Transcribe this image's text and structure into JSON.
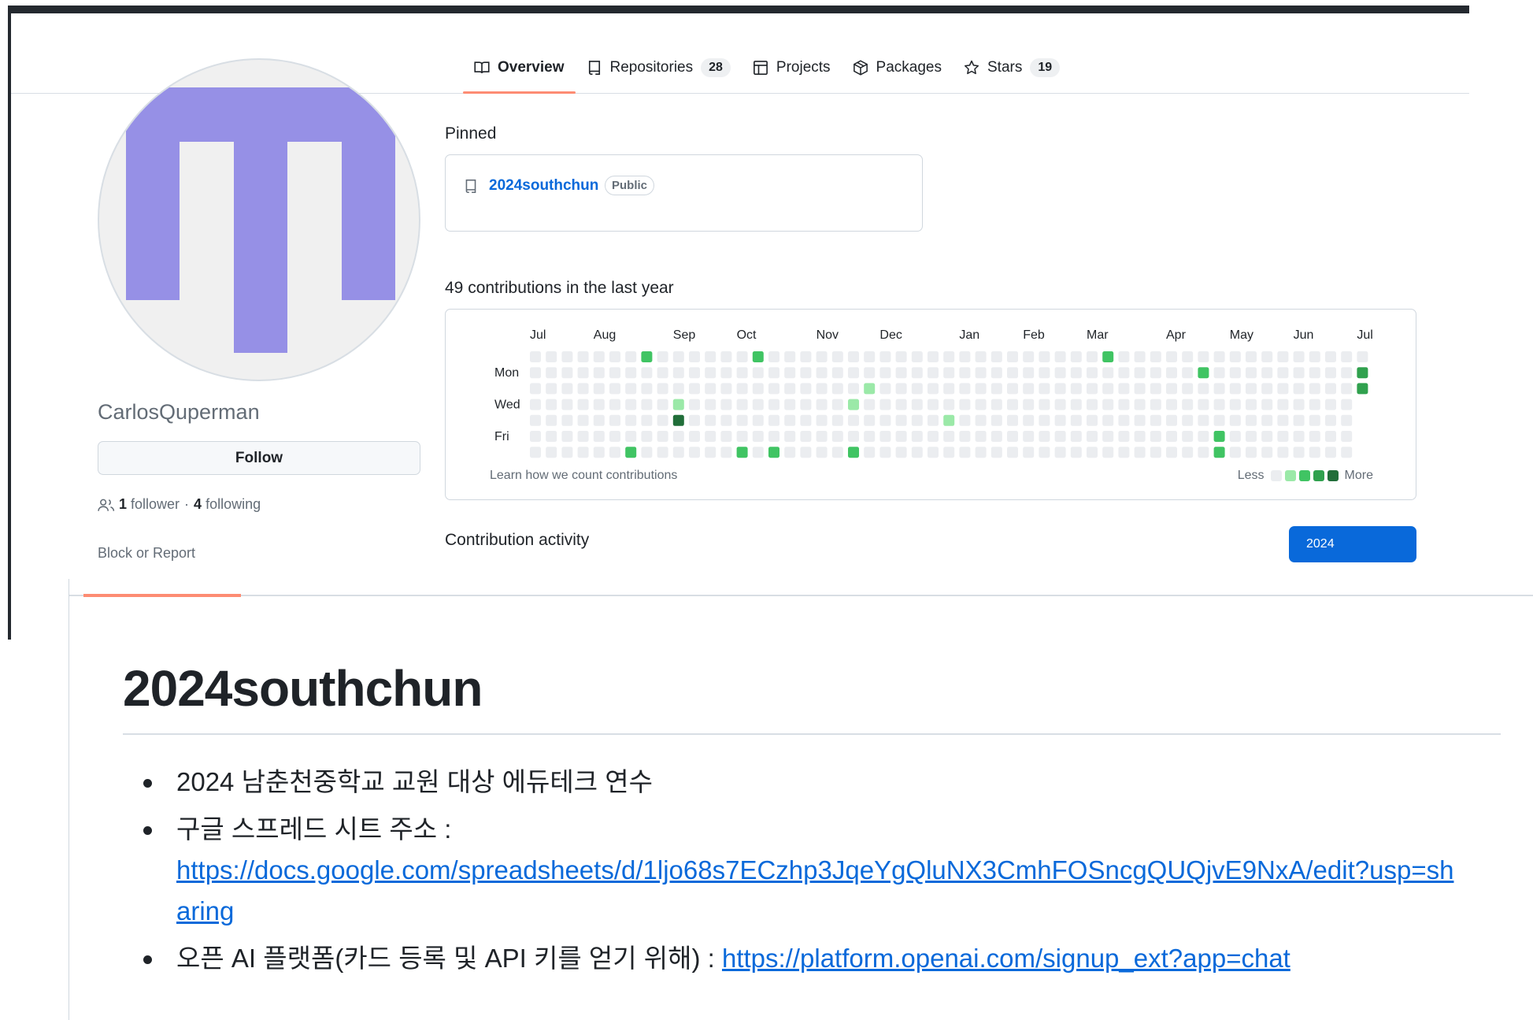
{
  "profile": {
    "username": "CarlosQuperman",
    "follow_label": "Follow",
    "followers_count": "1",
    "followers_label": "follower",
    "separator": "·",
    "following_count": "4",
    "following_label": "following",
    "block_label": "Block or Report",
    "avatar_color": "#9690e6"
  },
  "tabs": [
    {
      "label": "Overview",
      "icon": "book-icon",
      "active": true
    },
    {
      "label": "Repositories",
      "icon": "repo-icon",
      "count": "28"
    },
    {
      "label": "Projects",
      "icon": "table-icon"
    },
    {
      "label": "Packages",
      "icon": "package-icon"
    },
    {
      "label": "Stars",
      "icon": "star-icon",
      "count": "19"
    }
  ],
  "pinned": {
    "heading": "Pinned",
    "repo_name": "2024southchun",
    "visibility": "Public"
  },
  "contributions": {
    "heading": "49 contributions in the last year",
    "months": [
      "Jul",
      "Aug",
      "Sep",
      "Oct",
      "Nov",
      "Dec",
      "Jan",
      "Feb",
      "Mar",
      "Apr",
      "May",
      "Jun",
      "Jul"
    ],
    "days": [
      "Mon",
      "Wed",
      "Fri"
    ],
    "learn_label": "Learn how we count contributions",
    "less_label": "Less",
    "more_label": "More",
    "levels": [
      "#ebedf0",
      "#9be9a8",
      "#40c463",
      "#30a14e",
      "#216e39"
    ],
    "cells": [
      {
        "week": 7,
        "day": 0,
        "level": 2
      },
      {
        "week": 6,
        "day": 6,
        "level": 2
      },
      {
        "week": 9,
        "day": 3,
        "level": 1
      },
      {
        "week": 9,
        "day": 4,
        "level": 4
      },
      {
        "week": 14,
        "day": 0,
        "level": 2
      },
      {
        "week": 13,
        "day": 6,
        "level": 2
      },
      {
        "week": 15,
        "day": 6,
        "level": 2
      },
      {
        "week": 21,
        "day": 2,
        "level": 1
      },
      {
        "week": 20,
        "day": 3,
        "level": 1
      },
      {
        "week": 20,
        "day": 6,
        "level": 2
      },
      {
        "week": 26,
        "day": 4,
        "level": 1
      },
      {
        "week": 36,
        "day": 0,
        "level": 2
      },
      {
        "week": 42,
        "day": 1,
        "level": 2
      },
      {
        "week": 43,
        "day": 5,
        "level": 2
      },
      {
        "week": 43,
        "day": 6,
        "level": 2
      },
      {
        "week": 52,
        "day": 1,
        "level": 3
      },
      {
        "week": 52,
        "day": 2,
        "level": 3
      }
    ]
  },
  "activity": {
    "heading": "Contribution activity",
    "year": "2024"
  },
  "readme": {
    "title": "2024southchun",
    "items": [
      {
        "text": "2024 남춘천중학교 교원 대상 에듀테크 연수"
      },
      {
        "text": "구글 스프레드 시트 주소 :",
        "link": "https://docs.google.com/spreadsheets/d/1ljo68s7ECzhp3JqeYgQluNX3CmhFOSncgQUQjvE9NxA/edit?usp=sharing"
      },
      {
        "text": "오픈 AI 플랫폼(카드 등록 및 API 키를 얻기 위해) :",
        "link": "https://platform.openai.com/signup_ext?app=chat"
      }
    ]
  }
}
